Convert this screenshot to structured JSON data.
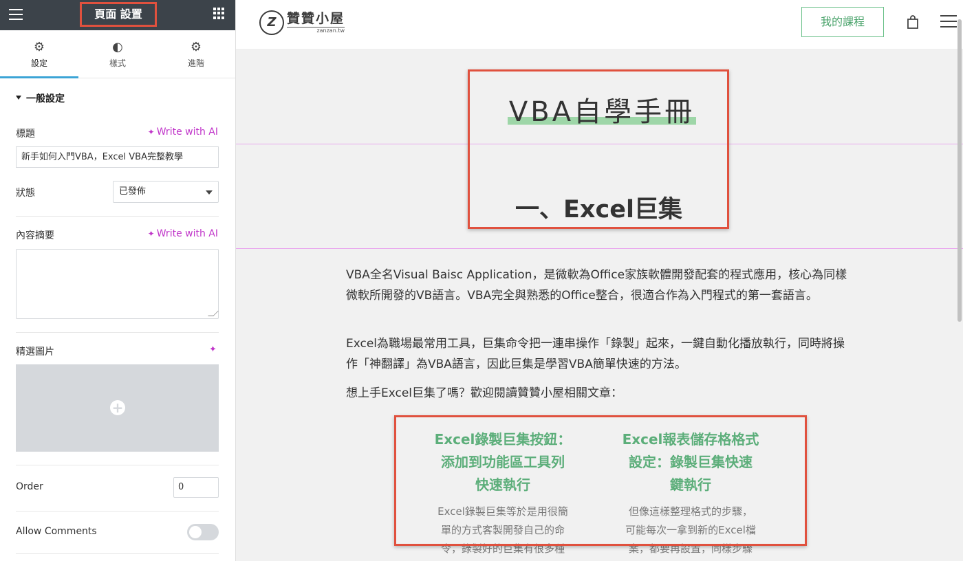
{
  "sidebar": {
    "header_title": "頁面 設置",
    "tabs": [
      {
        "label": "設定",
        "icon": "gear-icon",
        "active": true
      },
      {
        "label": "樣式",
        "icon": "contrast-icon",
        "active": false
      },
      {
        "label": "進階",
        "icon": "gear-icon",
        "active": false
      }
    ],
    "section_title": "一般設定",
    "title_label": "標題",
    "write_ai": "Write with AI",
    "title_value": "新手如何入門VBA，Excel VBA完整教學",
    "status_label": "狀態",
    "status_value": "已發佈",
    "excerpt_label": "內容摘要",
    "featured_image_label": "精選圖片",
    "order_label": "Order",
    "order_value": "0",
    "allow_comments_label": "Allow Comments",
    "accent_color": "#c036c9"
  },
  "site": {
    "logo_name": "贊贊小屋",
    "logo_domain": "zanzan.tw",
    "logo_letter": "Z",
    "my_course": "我的課程",
    "accent_color": "#4aa36b"
  },
  "content": {
    "hero_title": "VBA自學手冊",
    "section_heading": "一、Excel巨集",
    "paragraphs": [
      "VBA全名Visual Baisc Application，是微軟為Office家族軟體開發配套的程式應用，核心為同樣微軟所開發的VB語言。VBA完全與熟悉的Office整合，很適合作為入門程式的第一套語言。",
      "Excel為職場最常用工具，巨集命令把一連串操作「錄製」起來，一鍵自動化播放執行，同時將操作「神翻譯」為VBA語言，因此巨集是學習VBA簡單快速的方法。",
      "想上手Excel巨集了嗎？歡迎閱讀贊贊小屋相關文章："
    ],
    "cards": [
      {
        "title_lines": [
          "Excel錄製巨集按鈕：",
          "添加到功能區工具列",
          "快速執行"
        ],
        "excerpt_lines": [
          "Excel錄製巨集等於是用很簡",
          "單的方式客製開發自己的命",
          "令，錄製好的巨集有很多種"
        ]
      },
      {
        "title_lines": [
          "Excel報表儲存格格式",
          "設定：錄製巨集快速",
          "鍵執行"
        ],
        "excerpt_lines": [
          "但像這樣整理格式的步驟，",
          "可能每次一拿到新的Excel檔",
          "案，都要再設置，同樣步驟"
        ]
      }
    ]
  }
}
